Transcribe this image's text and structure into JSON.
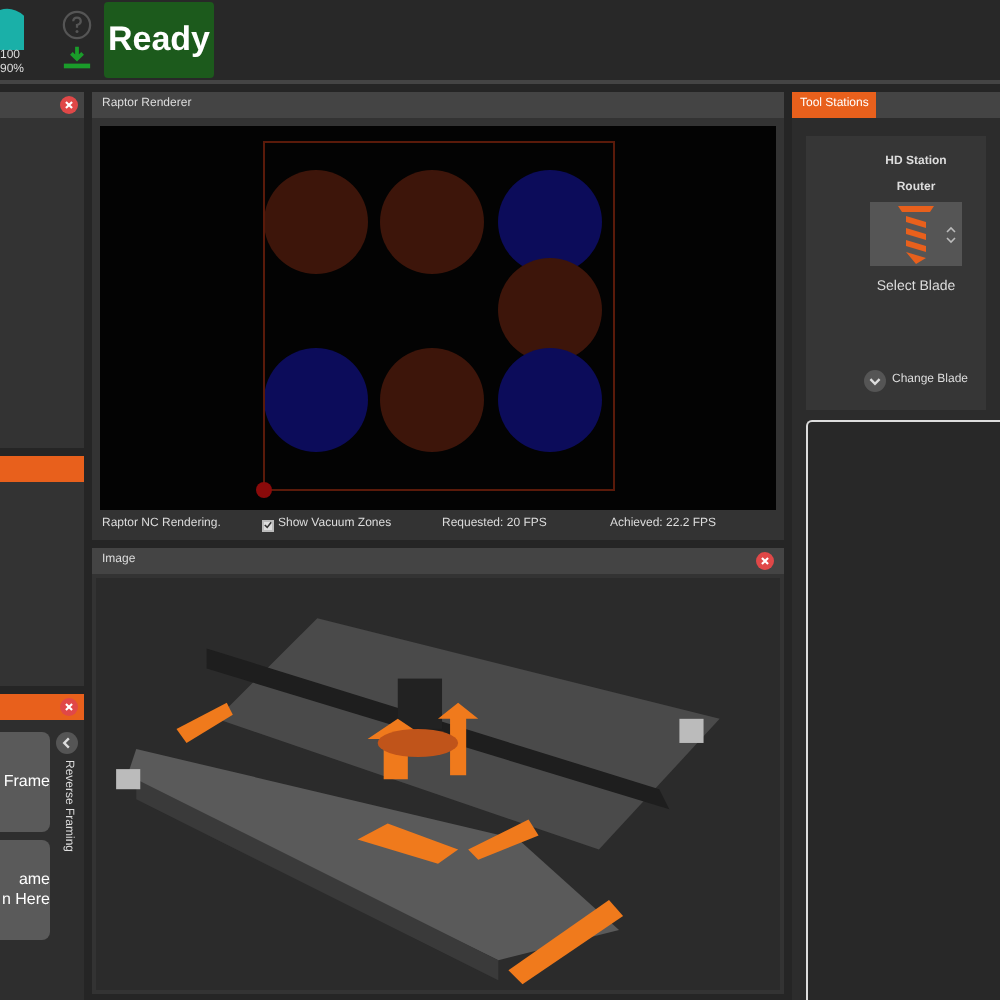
{
  "status": {
    "gauge_value": "100",
    "gauge_percent": "90%",
    "state": "Ready"
  },
  "framing": {
    "buttons": [
      {
        "lines": [
          "Frame"
        ]
      },
      {
        "lines": [
          "ame",
          "n Here"
        ]
      }
    ],
    "side_label": "Reverse Framing"
  },
  "renderer": {
    "title": "Raptor Renderer",
    "status": "Raptor NC Rendering.",
    "vacuum": {
      "label": "Show Vacuum Zones",
      "checked": true
    },
    "requested": "Requested: 20 FPS",
    "achieved": "Achieved: 22.2 FPS",
    "zones": [
      {
        "color": "#3d150a"
      },
      {
        "color": "#3d150a"
      },
      {
        "color": "#0c0c5a"
      },
      {
        "color": "#3d150a"
      },
      {
        "color": "#0c0c5a"
      },
      {
        "color": "#3d150a"
      },
      {
        "color": "#0c0c5a"
      }
    ]
  },
  "image": {
    "title": "Image"
  },
  "tool_stations": {
    "tab": {
      "label": "Tool Stations",
      "selected": true
    },
    "station": "HD Station",
    "tool": "Router",
    "action": "Select Blade",
    "change": "Change Blade"
  }
}
